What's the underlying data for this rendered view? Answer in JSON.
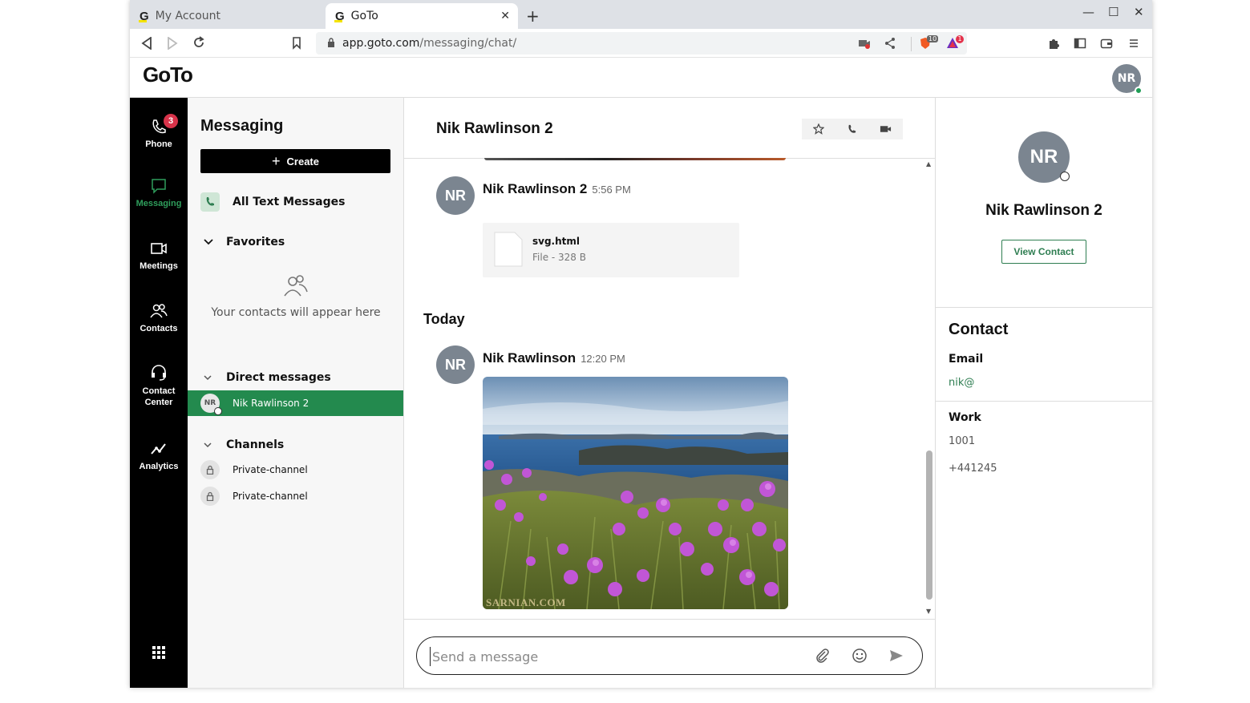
{
  "browser": {
    "tabs": [
      {
        "title": "My Account"
      },
      {
        "title": "GoTo"
      }
    ],
    "url_host": "app.goto.com",
    "url_path": "/messaging/chat/",
    "ext_badge_1": "10",
    "ext_badge_2": "1"
  },
  "app": {
    "logo_text": "GoTo",
    "user_initials": "NR"
  },
  "rail": {
    "items": [
      {
        "label": "Phone",
        "icon": "phone-icon",
        "badge": "3"
      },
      {
        "label": "Messaging",
        "icon": "chat-icon"
      },
      {
        "label": "Meetings",
        "icon": "video-icon"
      },
      {
        "label": "Contacts",
        "icon": "contacts-icon"
      },
      {
        "label": "Contact\nCenter",
        "label_line1": "Contact",
        "label_line2": "Center",
        "icon": "headset-icon"
      },
      {
        "label": "Analytics",
        "icon": "analytics-icon"
      }
    ]
  },
  "messaging": {
    "title": "Messaging",
    "create_label": "Create",
    "all_text_label": "All Text Messages",
    "favorites_label": "Favorites",
    "empty_contacts": "Your contacts will appear here",
    "dm_label": "Direct messages",
    "dm_items": [
      {
        "initials": "NR",
        "name": "Nik Rawlinson 2"
      }
    ],
    "channels_label": "Channels",
    "channels": [
      {
        "name": "Private-channel"
      },
      {
        "name": "Private-channel"
      }
    ]
  },
  "chat": {
    "title": "Nik Rawlinson 2",
    "messages": [
      {
        "initials": "NR",
        "sender": "Nik Rawlinson 2",
        "time": "5:56 PM",
        "file_name": "svg.html",
        "file_meta": "File - 328 B"
      },
      {
        "initials": "NR",
        "sender": "Nik Rawlinson",
        "time": "12:20 PM",
        "image_credit": "SARNIAN.COM"
      }
    ],
    "day_divider": "Today",
    "composer_placeholder": "Send a message"
  },
  "contact_panel": {
    "initials": "NR",
    "name": "Nik Rawlinson 2",
    "view_contact_label": "View Contact",
    "section_title": "Contact",
    "email_label": "Email",
    "email_value": "nik@",
    "work_label": "Work",
    "work_ext": "1001",
    "work_phone": "+441245"
  },
  "colors": {
    "accent_green": "#238a4e",
    "rail_bg": "#000000",
    "avatar_grey": "#7b8590",
    "badge_red": "#d8334a"
  }
}
